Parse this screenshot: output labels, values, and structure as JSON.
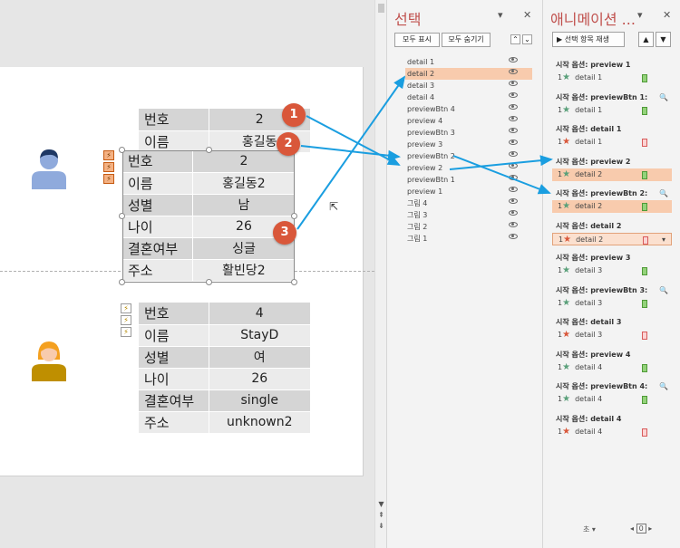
{
  "slide": {
    "record1_back": [
      [
        "번호",
        "2"
      ],
      [
        "이름",
        "홍길동"
      ]
    ],
    "record1": [
      [
        "번호",
        "2"
      ],
      [
        "이름",
        "홍길동2"
      ],
      [
        "성별",
        "남"
      ],
      [
        "나이",
        "26"
      ],
      [
        "결혼여부",
        "싱글"
      ],
      [
        "주소",
        "활빈당2"
      ]
    ],
    "record2": [
      [
        "번호",
        "4"
      ],
      [
        "이름",
        "StayD"
      ],
      [
        "성별",
        "여"
      ],
      [
        "나이",
        "26"
      ],
      [
        "결혼여부",
        "single"
      ],
      [
        "주소",
        "unknown2"
      ]
    ],
    "badges": [
      "1",
      "2",
      "3"
    ],
    "colors": {
      "badge": "#d9573a",
      "arrow": "#1a9ee0",
      "man": "#8faadc",
      "woman": "#f4a020"
    }
  },
  "selection_pane": {
    "title": "선택",
    "show_all": "모두 표시",
    "hide_all": "모두 숨기기",
    "items": [
      "detail 1",
      "detail 2",
      "detail 3",
      "detail 4",
      "previewBtn 4",
      "preview 4",
      "previewBtn 3",
      "preview 3",
      "previewBtn 2",
      "preview 2",
      "previewBtn 1",
      "preview 1",
      "그림 4",
      "그림 3",
      "그림 2",
      "그림 1"
    ],
    "highlighted": "detail 2"
  },
  "animation_pane": {
    "title": "애니메이션 ...",
    "play_label": "선택 항목 재생",
    "groups": [
      {
        "header": "시작 옵션: preview 1",
        "effect": "detail 1",
        "type": "entrance"
      },
      {
        "header": "시작 옵션: previewBtn 1:",
        "effect": "detail 1",
        "type": "entrance"
      },
      {
        "header": "시작 옵션: detail 1",
        "effect": "detail 1",
        "type": "exit"
      },
      {
        "header": "시작 옵션: preview 2",
        "effect": "detail 2",
        "type": "entrance"
      },
      {
        "header": "시작 옵션: previewBtn 2:",
        "effect": "detail 2",
        "type": "entrance"
      },
      {
        "header": "시작 옵션: detail 2",
        "effect": "detail 2",
        "type": "exit"
      },
      {
        "header": "시작 옵션: preview 3",
        "effect": "detail 3",
        "type": "entrance"
      },
      {
        "header": "시작 옵션: previewBtn 3:",
        "effect": "detail 3",
        "type": "entrance"
      },
      {
        "header": "시작 옵션: detail 3",
        "effect": "detail 3",
        "type": "exit"
      },
      {
        "header": "시작 옵션: preview 4",
        "effect": "detail 4",
        "type": "entrance"
      },
      {
        "header": "시작 옵션: previewBtn 4:",
        "effect": "detail 4",
        "type": "entrance"
      },
      {
        "header": "시작 옵션: detail 4",
        "effect": "detail 4",
        "type": "exit"
      }
    ],
    "effect_number": "1",
    "seconds_label": "초",
    "zoom_value": "0"
  }
}
